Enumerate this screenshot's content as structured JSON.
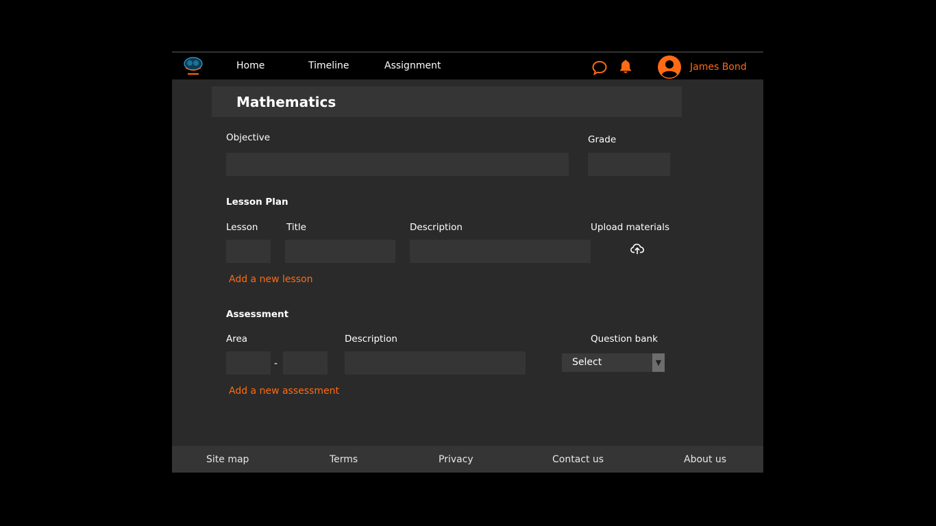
{
  "header": {
    "logo_icon": "app-logo",
    "nav": [
      "Home",
      "Timeline",
      "Assignment"
    ],
    "chat_icon": "chat-bubble-icon",
    "bell_icon": "bell-icon",
    "user_name": "James Bond",
    "accent_color": "#ff6b14"
  },
  "page": {
    "title": "Mathematics"
  },
  "form": {
    "objective_label": "Objective",
    "grade_label": "Grade",
    "lesson_plan": {
      "section_label": "Lesson Plan",
      "lesson_label": "Lesson",
      "title_label": "Title",
      "description_label": "Description",
      "upload_label": "Upload materials",
      "upload_icon": "cloud-upload-icon",
      "add_link": "Add a new lesson"
    },
    "assessment": {
      "section_label": "Assessment",
      "area_label": "Area",
      "area_separator": "-",
      "description_label": "Description",
      "question_bank_label": "Question bank",
      "select_value": "Select",
      "add_link": "Add a new assessment"
    }
  },
  "footer": {
    "links": [
      "Site map",
      "Terms",
      "Privacy",
      "Contact us",
      "About us"
    ]
  },
  "colors": {
    "background": "#000000",
    "panel": "#2a2a2a",
    "field": "#353535",
    "accent": "#ff6b14"
  }
}
